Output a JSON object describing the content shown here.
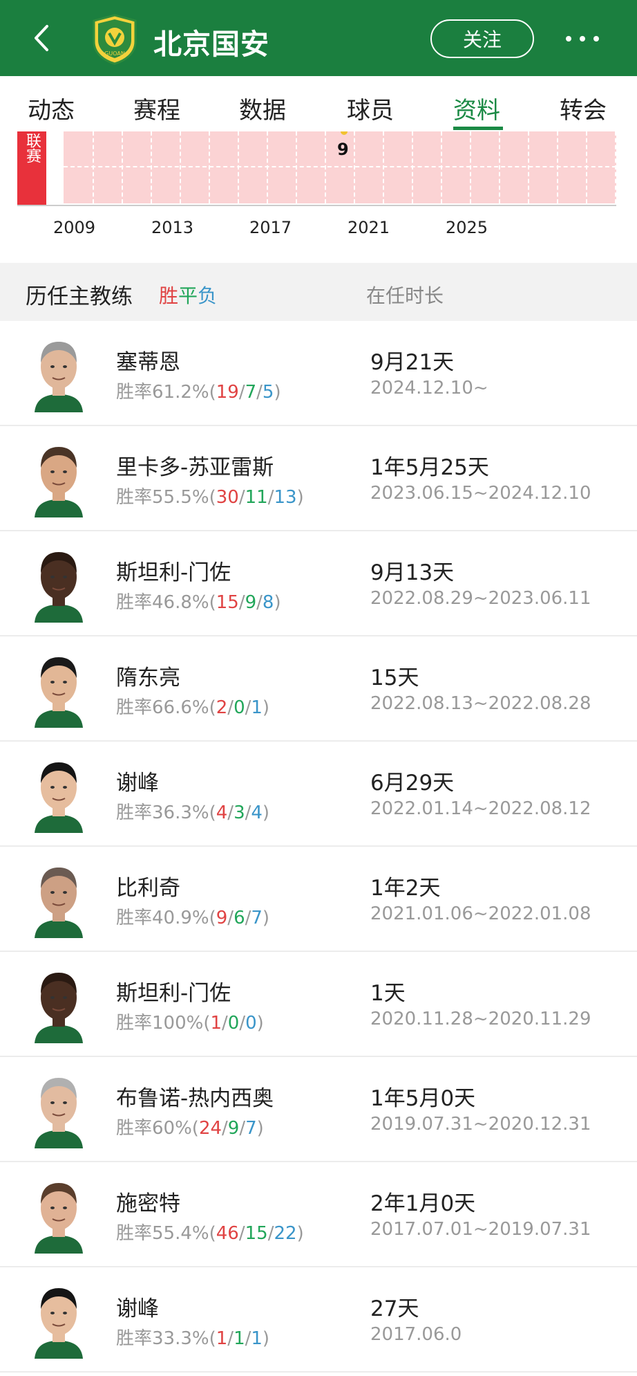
{
  "header": {
    "title": "北京国安",
    "follow_label": "关注",
    "logo_text": "GUOAN",
    "bg_color": "#1b7f3f"
  },
  "tabs": [
    {
      "label": "动态"
    },
    {
      "label": "赛程"
    },
    {
      "label": "数据"
    },
    {
      "label": "球员"
    },
    {
      "label": "资料",
      "active": true
    },
    {
      "label": "转会"
    }
  ],
  "chart_data": {
    "type": "table",
    "row_label": "联赛",
    "years": [
      "2009",
      "2013",
      "2017",
      "2021",
      "2025"
    ],
    "rank_label": "9",
    "rank_year": "2017",
    "cell_color": "#fbd3d4",
    "label_color": "#e8313b"
  },
  "coaches_section": {
    "title": "历任主教练",
    "legend": {
      "win": "胜",
      "draw": "平",
      "loss": "负"
    },
    "tenure_header": "在任时长"
  },
  "coaches": [
    {
      "name": "塞蒂恩",
      "rate": "胜率61.2%(",
      "w": "19",
      "d": "7",
      "l": "5",
      "tenure": "9月21天",
      "dates": "2024.12.10~",
      "skin": "#e0b79a",
      "hair": "#9a9a9a"
    },
    {
      "name": "里卡多-苏亚雷斯",
      "rate": "胜率55.5%(",
      "w": "30",
      "d": "11",
      "l": "13",
      "tenure": "1年5月25天",
      "dates": "2023.06.15~2024.12.10",
      "skin": "#d9a784",
      "hair": "#4a3426"
    },
    {
      "name": "斯坦利-门佐",
      "rate": "胜率46.8%(",
      "w": "15",
      "d": "9",
      "l": "8",
      "tenure": "9月13天",
      "dates": "2022.08.29~2023.06.11",
      "skin": "#4a2f22",
      "hair": "#2a1a12"
    },
    {
      "name": "隋东亮",
      "rate": "胜率66.6%(",
      "w": "2",
      "d": "0",
      "l": "1",
      "tenure": "15天",
      "dates": "2022.08.13~2022.08.28",
      "skin": "#e2b796",
      "hair": "#1a1a1a"
    },
    {
      "name": "谢峰",
      "rate": "胜率36.3%(",
      "w": "4",
      "d": "3",
      "l": "4",
      "tenure": "6月29天",
      "dates": "2022.01.14~2022.08.12",
      "skin": "#e6bd9e",
      "hair": "#151515"
    },
    {
      "name": "比利奇",
      "rate": "胜率40.9%(",
      "w": "9",
      "d": "6",
      "l": "7",
      "tenure": "1年2天",
      "dates": "2021.01.06~2022.01.08",
      "skin": "#cda084",
      "hair": "#6b5b52"
    },
    {
      "name": "斯坦利-门佐",
      "rate": "胜率100%(",
      "w": "1",
      "d": "0",
      "l": "0",
      "tenure": "1天",
      "dates": "2020.11.28~2020.11.29",
      "skin": "#4a2f22",
      "hair": "#2a1a12"
    },
    {
      "name": "布鲁诺-热内西奥",
      "rate": "胜率60%(",
      "w": "24",
      "d": "9",
      "l": "7",
      "tenure": "1年5月0天",
      "dates": "2019.07.31~2020.12.31",
      "skin": "#e2bba0",
      "hair": "#b0b0b0"
    },
    {
      "name": "施密特",
      "rate": "胜率55.4%(",
      "w": "46",
      "d": "15",
      "l": "22",
      "tenure": "2年1月0天",
      "dates": "2017.07.01~2019.07.31",
      "skin": "#e0b295",
      "hair": "#5a3e2c"
    },
    {
      "name": "谢峰",
      "rate": "胜率33.3%(",
      "w": "1",
      "d": "1",
      "l": "1",
      "tenure": "27天",
      "dates": "2017.06.0",
      "skin": "#e6bd9e",
      "hair": "#151515"
    }
  ]
}
